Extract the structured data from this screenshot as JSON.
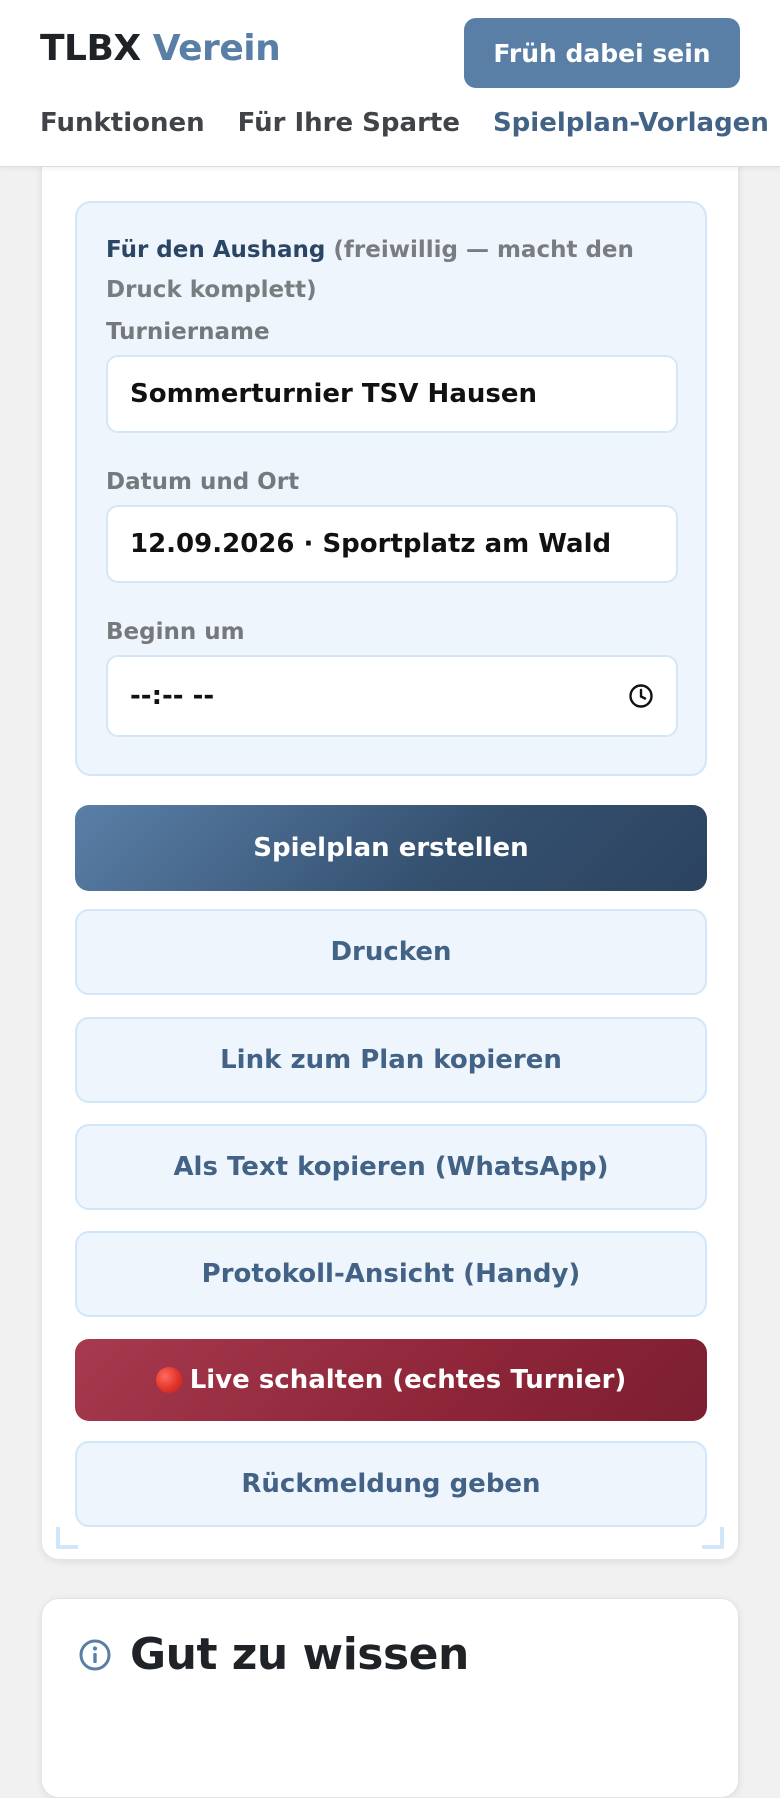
{
  "header": {
    "brand_main": "TLBX",
    "brand_accent": "Verein",
    "cta_label": "Früh dabei sein",
    "nav": [
      {
        "label": "Funktionen"
      },
      {
        "label": "Für Ihre Sparte"
      },
      {
        "label": "Spielplan-Vorlagen"
      }
    ]
  },
  "aushang": {
    "heading_lead": "Für den Aushang",
    "heading_note": "(freiwillig — macht den Druck komplett)",
    "turniername": {
      "label": "Turniername",
      "value": "Sommerturnier TSV Hausen"
    },
    "datum_ort": {
      "label": "Datum und Ort",
      "value": "12.09.2026 · Sportplatz am Wald"
    },
    "beginn": {
      "label": "Beginn um",
      "value": "--:-- --"
    }
  },
  "actions": {
    "create": "Spielplan erstellen",
    "print": "Drucken",
    "copy_link": "Link zum Plan kopieren",
    "copy_text": "Als Text kopieren (WhatsApp)",
    "protocol": "Protokoll-Ansicht (Handy)",
    "live": "Live schalten (echtes Turnier)",
    "feedback": "Rückmeldung geben"
  },
  "info_card": {
    "title": "Gut zu wissen"
  },
  "colors": {
    "accent": "#5a7fa7",
    "accent_dark": "#2b435f",
    "danger": "#8e2538",
    "panel_bg": "#eef5fd",
    "panel_border": "#d2e6fa"
  }
}
